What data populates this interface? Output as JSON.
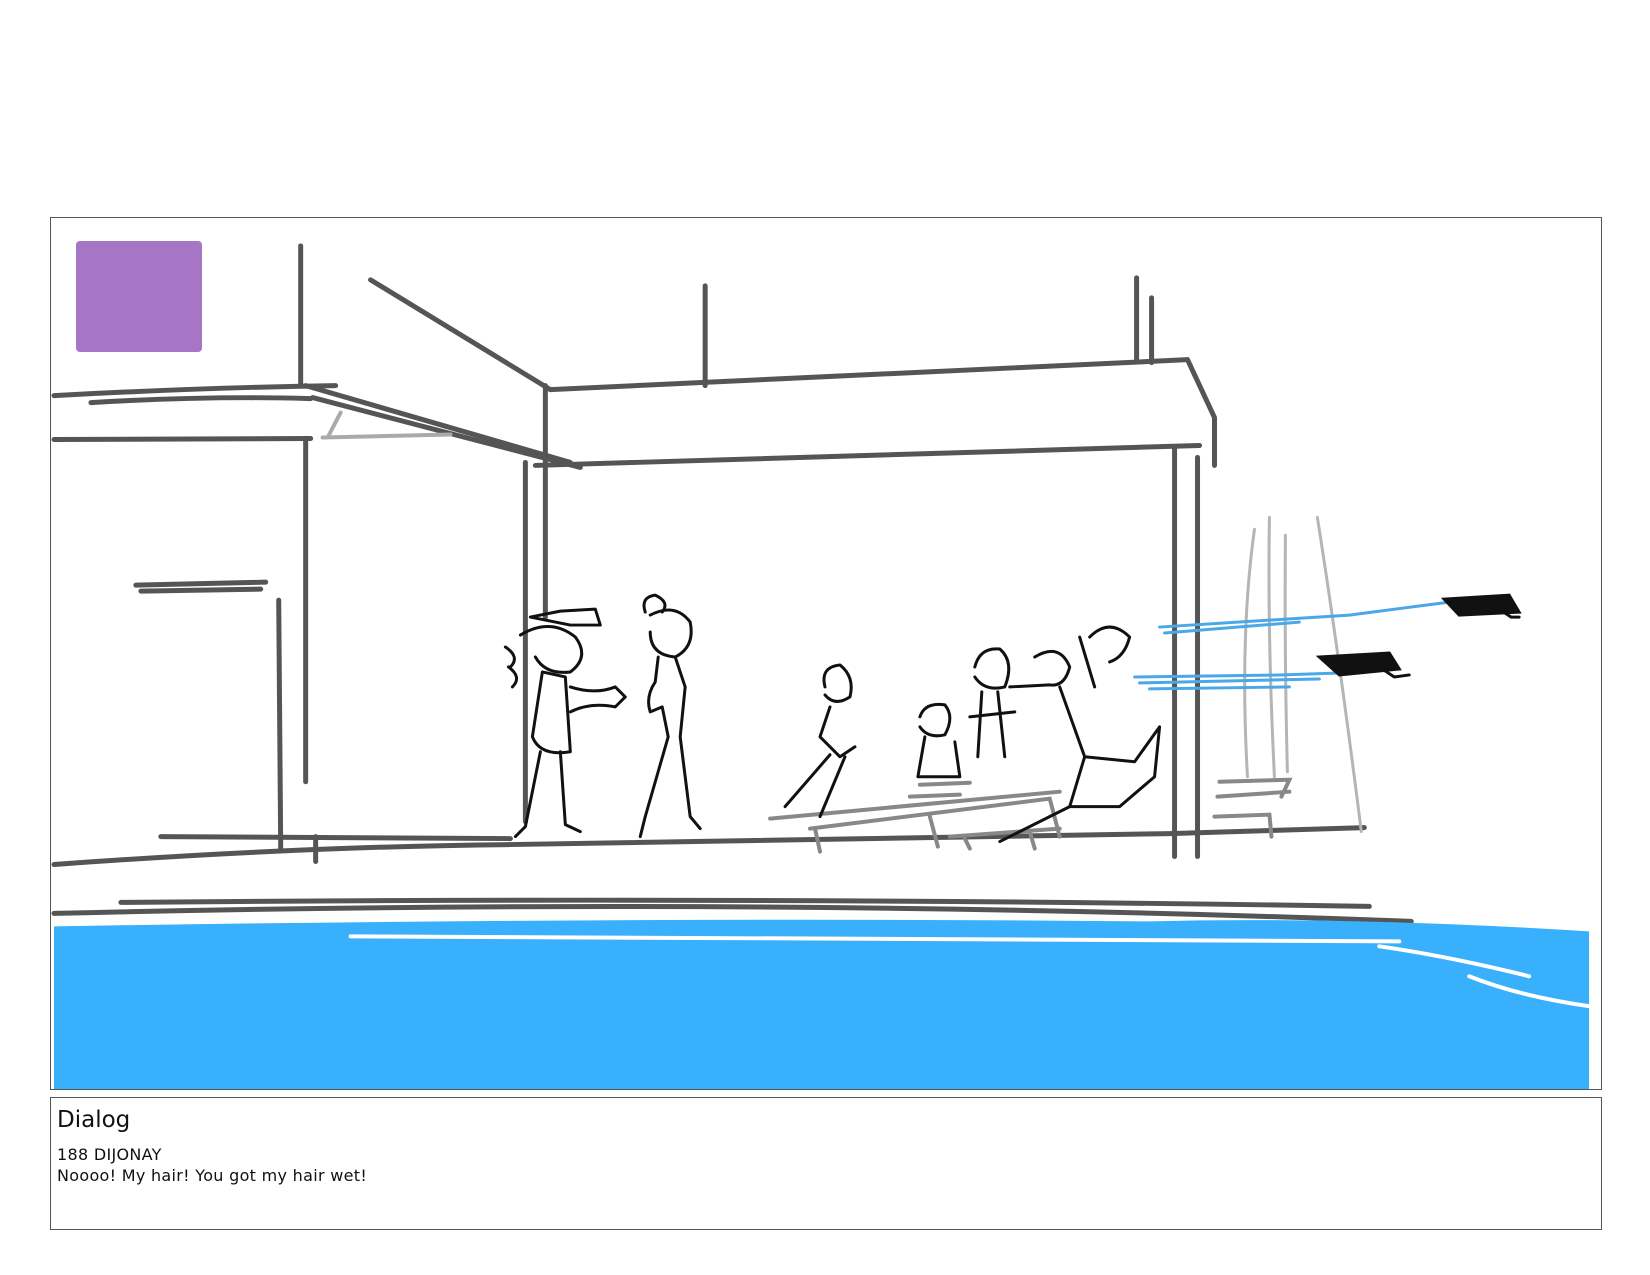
{
  "panel": {
    "swatch_color": "#A675C6",
    "water_color": "#38B0FC",
    "splash_color": "#4AA8E8"
  },
  "dialog": {
    "heading": "Dialog",
    "speaker": "188 DIJONAY",
    "line": "Noooo! My hair! You got my hair wet!"
  }
}
